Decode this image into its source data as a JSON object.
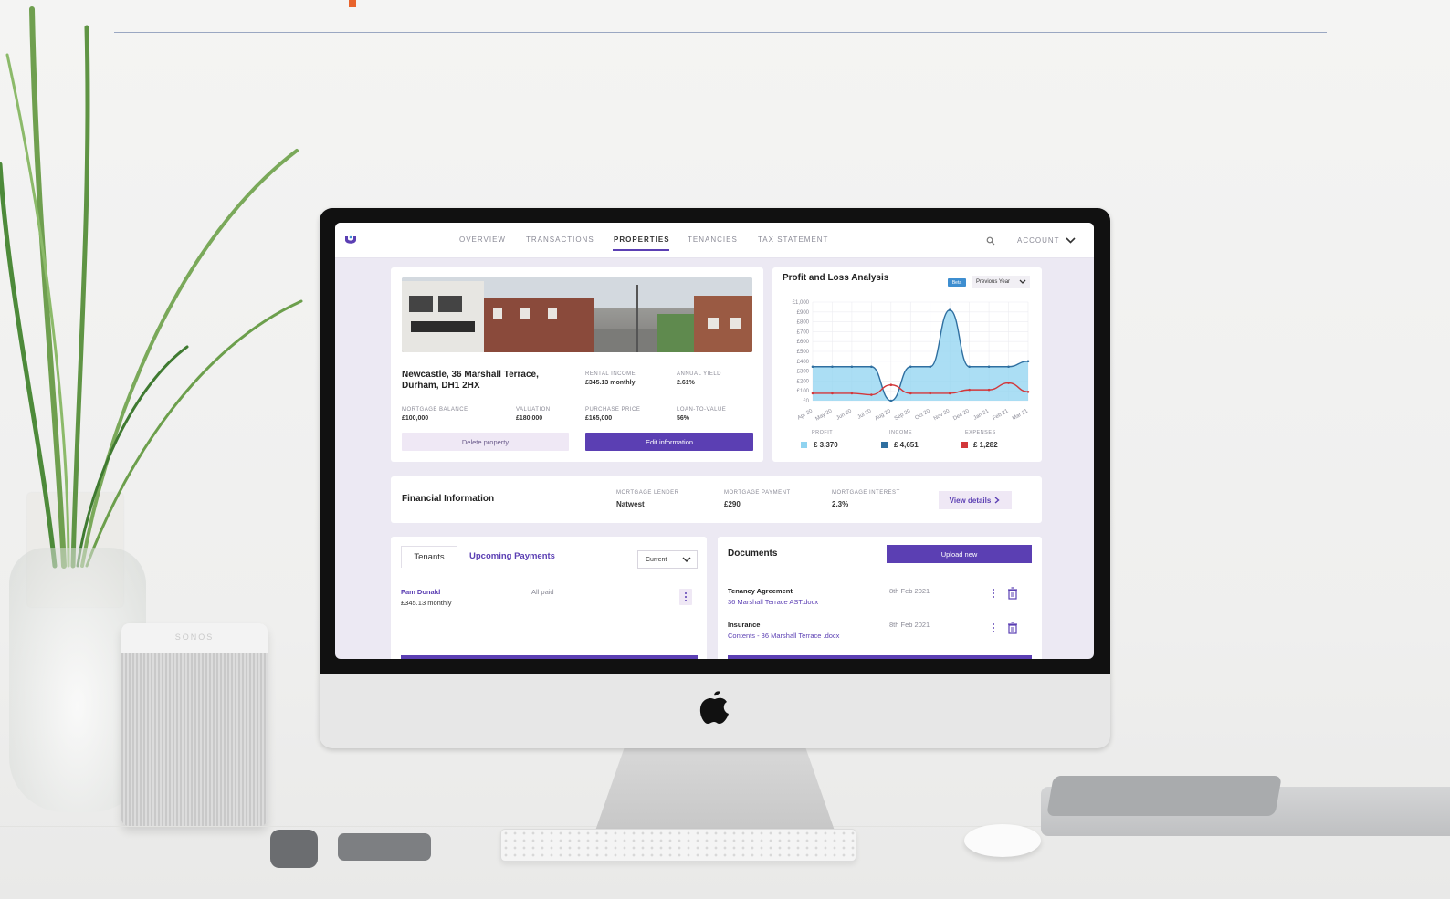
{
  "nav": {
    "tabs": [
      "OVERVIEW",
      "TRANSACTIONS",
      "PROPERTIES",
      "TENANCIES",
      "TAX STATEMENT"
    ],
    "active_tab": "PROPERTIES",
    "account": "ACCOUNT"
  },
  "property": {
    "address": "Newcastle, 36 Marshall Terrace, Durham, DH1 2HX",
    "rental_income_label": "RENTAL INCOME",
    "rental_income": "£345.13 monthly",
    "annual_yield_label": "ANNUAL YIELD",
    "annual_yield": "2.61%",
    "mortgage_balance_label": "MORTGAGE BALANCE",
    "mortgage_balance": "£100,000",
    "valuation_label": "VALUATION",
    "valuation": "£180,000",
    "purchase_price_label": "PURCHASE PRICE",
    "purchase_price": "£165,000",
    "ltv_label": "LOAN-TO-VALUE",
    "ltv": "56%",
    "delete_label": "Delete property",
    "edit_label": "Edit information"
  },
  "pl": {
    "title": "Profit and Loss Analysis",
    "beta": "Beta",
    "period": "Previous Year",
    "profit_label": "PROFIT",
    "profit": "£ 3,370",
    "income_label": "INCOME",
    "income": "£ 4,651",
    "expenses_label": "EXPENSES",
    "expenses": "£ 1,282",
    "colors": {
      "profit": "#8fd3f0",
      "income": "#2f6fa0",
      "expenses": "#d2373a"
    }
  },
  "chart_data": {
    "type": "area",
    "title": "Profit and Loss Analysis",
    "x": [
      "Apr 20",
      "May 20",
      "Jun 20",
      "Jul 20",
      "Aug 20",
      "Sep 20",
      "Oct 20",
      "Nov 20",
      "Dec 20",
      "Jan 21",
      "Feb 21",
      "Mar 21"
    ],
    "y_ticks": [
      "£0",
      "£100",
      "£200",
      "£300",
      "£400",
      "£500",
      "£600",
      "£700",
      "£800",
      "£900",
      "£1,000"
    ],
    "ylim": [
      0,
      1000
    ],
    "grid": true,
    "series": [
      {
        "name": "INCOME",
        "values": [
          345,
          345,
          345,
          345,
          0,
          345,
          345,
          920,
          345,
          345,
          345,
          400
        ]
      },
      {
        "name": "EXPENSES",
        "values": [
          75,
          75,
          75,
          60,
          160,
          75,
          75,
          75,
          110,
          110,
          180,
          90
        ]
      }
    ]
  },
  "financial": {
    "title": "Financial Information",
    "lender_label": "MORTGAGE LENDER",
    "lender": "Natwest",
    "payment_label": "MORTGAGE PAYMENT",
    "payment": "£290",
    "interest_label": "MORTGAGE INTEREST",
    "interest": "2.3%",
    "view_label": "View details"
  },
  "tenants": {
    "tab_tenants": "Tenants",
    "tab_upcoming": "Upcoming Payments",
    "filter": "Current",
    "name": "Pam Donald",
    "rent": "£345.13 monthly",
    "status": "All paid"
  },
  "documents": {
    "title": "Documents",
    "upload_label": "Upload new",
    "items": [
      {
        "name": "Tenancy Agreement",
        "file": "36 Marshall Terrace AST.docx",
        "date": "8th Feb 2021"
      },
      {
        "name": "Insurance",
        "file": "Contents - 36 Marshall Terrace .docx",
        "date": "8th Feb 2021"
      }
    ]
  },
  "desk": {
    "speaker_brand": "SONOS"
  }
}
